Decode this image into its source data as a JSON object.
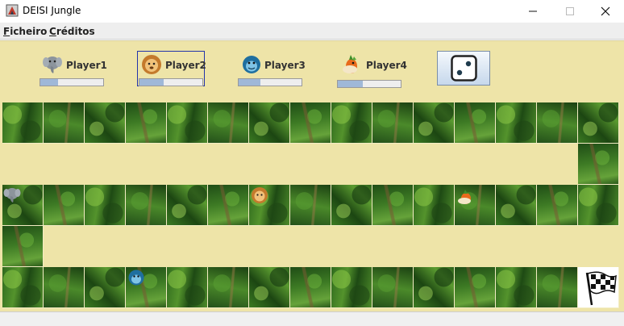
{
  "window": {
    "title": "DEISI Jungle",
    "icon": "app-icon",
    "controls": [
      "minimize-icon",
      "maximize-icon",
      "close-icon"
    ]
  },
  "menu": {
    "ficheiro": {
      "mnemonic": "F",
      "rest": "icheiro"
    },
    "creditos": {
      "mnemonic": "C",
      "rest": "réditos"
    }
  },
  "players": [
    {
      "name": "Player1",
      "icon": "elephant-icon",
      "energy_fraction": 0.28,
      "selected": false
    },
    {
      "name": "Player2",
      "icon": "lion-icon",
      "energy_fraction": 0.38,
      "selected": true
    },
    {
      "name": "Player3",
      "icon": "monkey-icon",
      "energy_fraction": 0.35,
      "selected": false
    },
    {
      "name": "Player4",
      "icon": "bird-icon",
      "energy_fraction": 0.4,
      "selected": false
    }
  ],
  "dice": {
    "icon": "dice-icon",
    "value": 2
  },
  "board": {
    "columns": 15,
    "rows": 5,
    "tokens": [
      {
        "player": "Player1",
        "icon": "elephant-icon",
        "row": 2,
        "col": 0
      },
      {
        "player": "Player2",
        "icon": "lion-icon",
        "row": 2,
        "col": 6
      },
      {
        "player": "Player3",
        "icon": "monkey-icon",
        "row": 4,
        "col": 3
      },
      {
        "player": "Player4",
        "icon": "bird-icon",
        "row": 2,
        "col": 11
      }
    ],
    "finish_icon": "checkered-flag-icon"
  },
  "colors": {
    "panel_background": "#eee4a8",
    "selected_border": "#2233aa",
    "progress_fill": "#9fb8d8"
  }
}
